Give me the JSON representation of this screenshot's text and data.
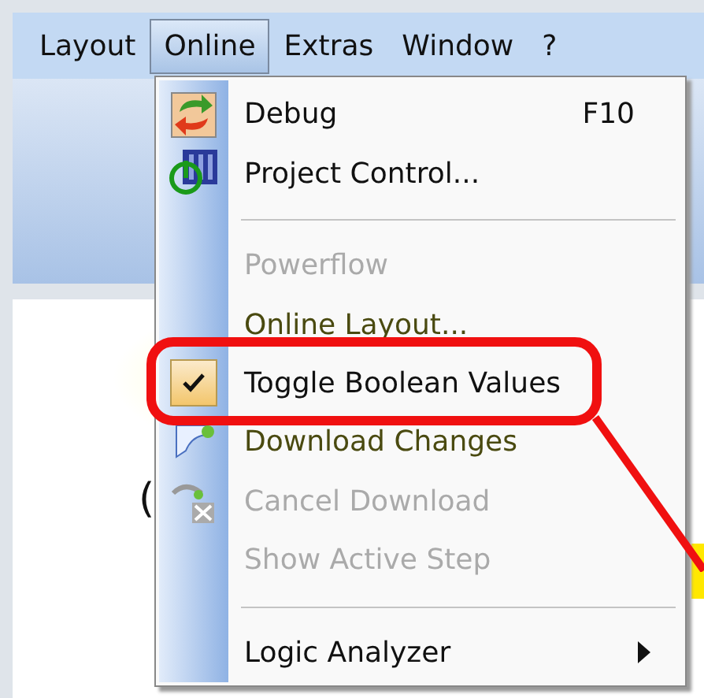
{
  "menu_bar": [
    {
      "label": "Layout",
      "selected": false
    },
    {
      "label": "Online",
      "selected": true
    },
    {
      "label": "Extras",
      "selected": false
    },
    {
      "label": "Window",
      "selected": false
    },
    {
      "label": "?",
      "selected": false
    }
  ],
  "menu": {
    "items": [
      {
        "kind": "item",
        "label": "Debug",
        "shortcut": "F10",
        "disabled": false,
        "checked": false
      },
      {
        "kind": "item",
        "label": "Project Control...",
        "disabled": false,
        "checked": false
      },
      {
        "kind": "separator"
      },
      {
        "kind": "item",
        "label": "Powerflow",
        "disabled": true,
        "checked": false
      },
      {
        "kind": "item",
        "label": "Online Layout...",
        "disabled": false,
        "checked": false
      },
      {
        "kind": "item",
        "label": "Toggle Boolean Values",
        "disabled": false,
        "checked": true
      },
      {
        "kind": "item",
        "label": "Download Changes",
        "disabled": false,
        "checked": false
      },
      {
        "kind": "item",
        "label": "Cancel Download",
        "disabled": true,
        "checked": false
      },
      {
        "kind": "item",
        "label": "Show Active Step",
        "disabled": true,
        "checked": false
      },
      {
        "kind": "separator"
      },
      {
        "kind": "submenu",
        "label": "Logic Analyzer",
        "disabled": false,
        "checked": false
      }
    ]
  },
  "canvas": {
    "text": "("
  }
}
